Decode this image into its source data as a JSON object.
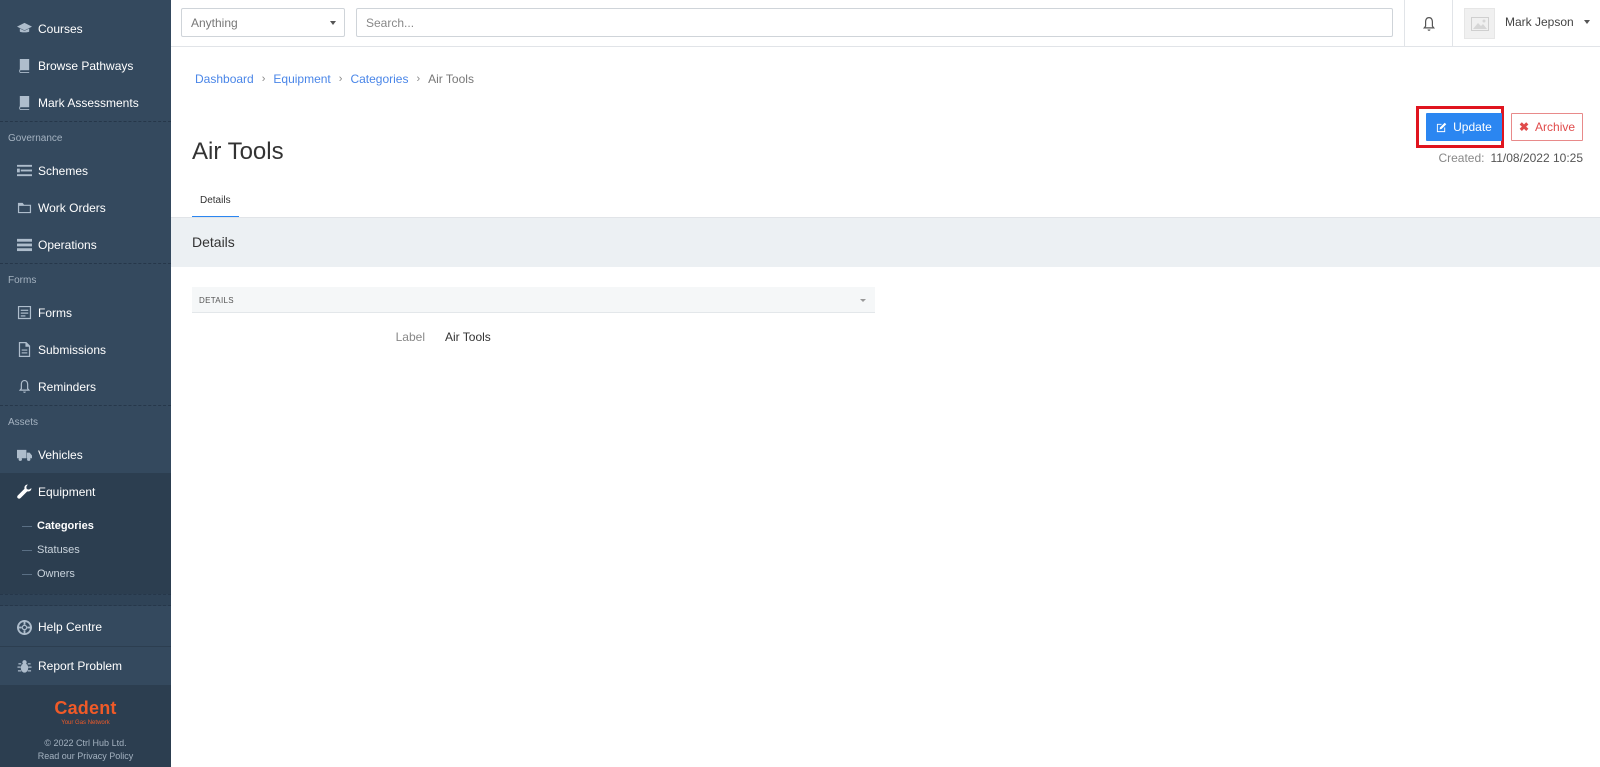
{
  "sidebar": {
    "items_top": [
      {
        "label": "Courses",
        "icon": "graduation-cap-icon"
      },
      {
        "label": "Browse Pathways",
        "icon": "book-icon"
      },
      {
        "label": "Mark Assessments",
        "icon": "book-icon"
      }
    ],
    "sections": {
      "governance": "Governance",
      "forms": "Forms",
      "assets": "Assets"
    },
    "governance_items": [
      {
        "label": "Schemes",
        "icon": "list-icon"
      },
      {
        "label": "Work Orders",
        "icon": "folder-icon"
      },
      {
        "label": "Operations",
        "icon": "server-icon"
      }
    ],
    "forms_items": [
      {
        "label": "Forms",
        "icon": "form-icon"
      },
      {
        "label": "Submissions",
        "icon": "document-icon"
      },
      {
        "label": "Reminders",
        "icon": "bell-icon"
      }
    ],
    "assets_items": [
      {
        "label": "Vehicles",
        "icon": "truck-icon"
      },
      {
        "label": "Equipment",
        "icon": "wrench-icon"
      }
    ],
    "equipment_sub": [
      {
        "label": "Categories",
        "active": true
      },
      {
        "label": "Statuses",
        "active": false
      },
      {
        "label": "Owners",
        "active": false
      }
    ],
    "help": [
      {
        "label": "Help Centre",
        "icon": "lifebuoy-icon"
      },
      {
        "label": "Report Problem",
        "icon": "bug-icon"
      }
    ],
    "brand": {
      "logo": "Cadent",
      "tagline": "Your Gas Network",
      "copyright": "© 2022 Ctrl Hub Ltd.",
      "privacy": "Read our Privacy Policy",
      "color": "#f05a28"
    }
  },
  "topbar": {
    "select_value": "Anything",
    "search_placeholder": "Search...",
    "user_name": "Mark Jepson"
  },
  "breadcrumb": {
    "items": [
      "Dashboard",
      "Equipment",
      "Categories"
    ],
    "current": "Air Tools"
  },
  "page": {
    "title": "Air Tools",
    "update_label": "Update",
    "archive_label": "Archive",
    "created_label": "Created:",
    "created_value": "11/08/2022 10:25",
    "tab_label": "Details",
    "section_title": "Details",
    "panel_title": "DETAILS",
    "field_label": "Label",
    "field_value": "Air Tools"
  },
  "colors": {
    "sidebar_bg": "#34495e",
    "primary": "#2b86f1",
    "danger": "#e04b4b",
    "highlight": "#e0141e"
  }
}
